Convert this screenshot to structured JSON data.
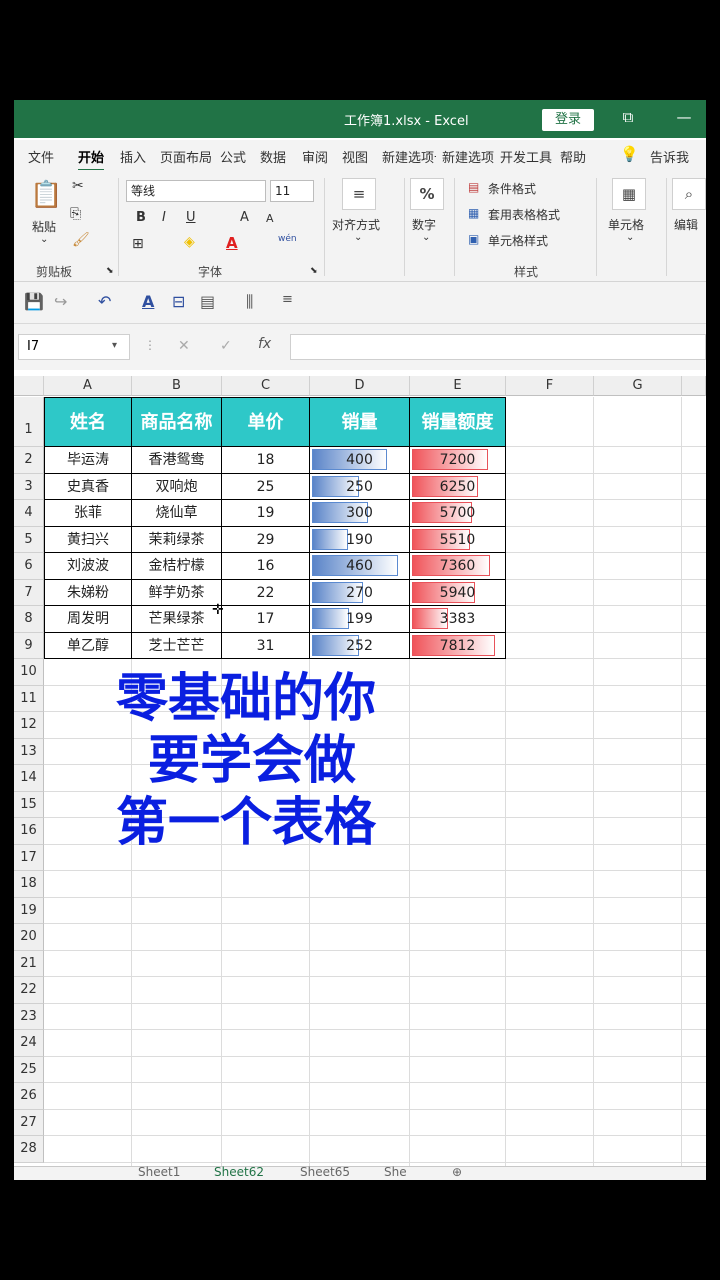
{
  "titlebar": {
    "title": "工作簿1.xlsx  -  Excel",
    "login": "登录",
    "restore_icon": "⧉",
    "minimize_icon": "—"
  },
  "tabs": [
    "文件",
    "开始",
    "插入",
    "页面布局",
    "公式",
    "数据",
    "审阅",
    "视图",
    "新建选项卡",
    "新建选项卡",
    "开发工具",
    "帮助",
    "告诉我"
  ],
  "ribbon": {
    "clipboard": {
      "paste": "粘贴",
      "label": "剪贴板"
    },
    "font": {
      "name": "等线",
      "size": "11",
      "label": "字体",
      "bold": "B",
      "italic": "I",
      "underline": "U",
      "grow": "A",
      "shrink": "A",
      "phonetic": "wén"
    },
    "align": {
      "label": "对齐方式"
    },
    "number": {
      "label": "数字",
      "icon": "%"
    },
    "styles": {
      "cond": "条件格式",
      "table": "套用表格格式",
      "cell": "单元格样式",
      "label": "样式"
    },
    "cells": {
      "label": "单元格"
    },
    "edit": {
      "label": "编辑"
    }
  },
  "namebox": "I7",
  "columns": [
    "A",
    "B",
    "C",
    "D",
    "E",
    "F",
    "G"
  ],
  "rows": [
    "1",
    "2",
    "3",
    "4",
    "5",
    "6",
    "7",
    "8",
    "9",
    "10",
    "11",
    "12",
    "13",
    "14",
    "15",
    "16",
    "17",
    "18",
    "19",
    "20",
    "21",
    "22",
    "23",
    "24",
    "25",
    "26",
    "27",
    "28"
  ],
  "table": {
    "headers": [
      "姓名",
      "商品名称",
      "单价",
      "销量",
      "销量额度"
    ],
    "rows": [
      {
        "name": "毕运涛",
        "product": "香港鸳鸯",
        "price": "18",
        "qty": "400",
        "amount": "7200",
        "qty_v": 400,
        "amount_v": 7200
      },
      {
        "name": "史真香",
        "product": "双响炮",
        "price": "25",
        "qty": "250",
        "amount": "6250",
        "qty_v": 250,
        "amount_v": 6250
      },
      {
        "name": "张菲",
        "product": "烧仙草",
        "price": "19",
        "qty": "300",
        "amount": "5700",
        "qty_v": 300,
        "amount_v": 5700
      },
      {
        "name": "黄扫兴",
        "product": "茉莉绿茶",
        "price": "29",
        "qty": "190",
        "amount": "5510",
        "qty_v": 190,
        "amount_v": 5510
      },
      {
        "name": "刘波波",
        "product": "金桔柠檬",
        "price": "16",
        "qty": "460",
        "amount": "7360",
        "qty_v": 460,
        "amount_v": 7360
      },
      {
        "name": "朱娣粉",
        "product": "鲜芋奶茶",
        "price": "22",
        "qty": "270",
        "amount": "5940",
        "qty_v": 270,
        "amount_v": 5940
      },
      {
        "name": "周发明",
        "product": "芒果绿茶",
        "price": "17",
        "qty": "199",
        "amount": "3383",
        "qty_v": 199,
        "amount_v": 3383
      },
      {
        "name": "单乙醇",
        "product": "芝士芒芒",
        "price": "31",
        "qty": "252",
        "amount": "7812",
        "qty_v": 252,
        "amount_v": 7812
      }
    ]
  },
  "overlay": {
    "line1": "零基础的你",
    "line2": "要学会做",
    "line3": "第一个表格"
  },
  "sheets": [
    "Sheet1",
    "Sheet62",
    "Sheet65",
    "She"
  ],
  "colors": {
    "excel_green": "#217346",
    "header_teal": "#2ec8c8",
    "overlay_blue": "#0a1fe0",
    "databar_blue": "#5a84c8",
    "databar_red": "#f0545a"
  }
}
